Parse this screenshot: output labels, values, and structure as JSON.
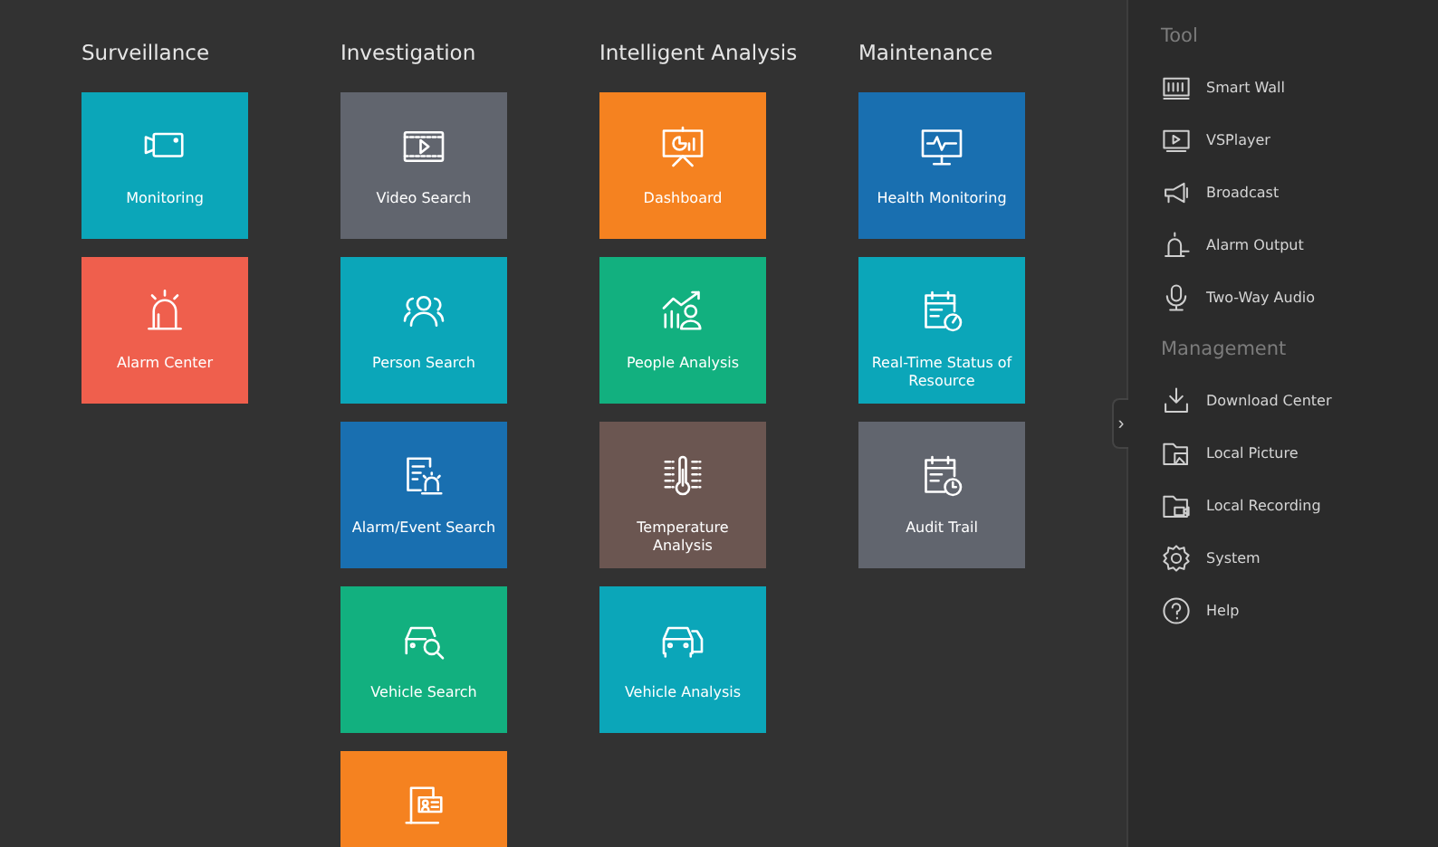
{
  "columns": [
    {
      "title": "Surveillance",
      "tiles": [
        {
          "label": "Monitoring",
          "color": "#0ba6b9"
        },
        {
          "label": "Alarm Center",
          "color": "#ef5f4d"
        }
      ]
    },
    {
      "title": "Investigation",
      "tiles": [
        {
          "label": "Video Search",
          "color": "#61656e"
        },
        {
          "label": "Person Search",
          "color": "#0ba6b9"
        },
        {
          "label": "Alarm/Event Search",
          "color": "#196fb0"
        },
        {
          "label": "Vehicle Search",
          "color": "#12b07f"
        },
        {
          "color": "#f58220"
        }
      ]
    },
    {
      "title": "Intelligent Analysis",
      "tiles": [
        {
          "label": "Dashboard",
          "color": "#f58220"
        },
        {
          "label": "People Analysis",
          "color": "#12b07f"
        },
        {
          "label": "Temperature Analysis",
          "color": "#6b5651"
        },
        {
          "label": "Vehicle Analysis",
          "color": "#0ba6b9"
        }
      ]
    },
    {
      "title": "Maintenance",
      "tiles": [
        {
          "label": "Health Monitoring",
          "color": "#196fb0"
        },
        {
          "label": "Real-Time Status of Resource",
          "color": "#0ba6b9"
        },
        {
          "label": "Audit Trail",
          "color": "#61656e"
        }
      ]
    }
  ],
  "sidebar": {
    "toggle": "›",
    "sections": [
      {
        "title": "Tool",
        "items": [
          {
            "label": "Smart Wall"
          },
          {
            "label": "VSPlayer"
          },
          {
            "label": "Broadcast"
          },
          {
            "label": "Alarm Output"
          },
          {
            "label": "Two-Way Audio"
          }
        ]
      },
      {
        "title": "Management",
        "items": [
          {
            "label": "Download Center"
          },
          {
            "label": "Local Picture"
          },
          {
            "label": "Local Recording"
          },
          {
            "label": "System"
          },
          {
            "label": "Help"
          }
        ]
      }
    ]
  }
}
